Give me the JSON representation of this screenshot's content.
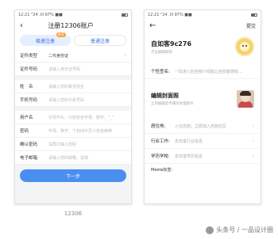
{
  "left_phone": {
    "status_time": "12:21 \"24 .lll 97% ■■",
    "title": "注册12306账户",
    "tabs": [
      {
        "label": "极速注册",
        "badge": "推荐"
      },
      {
        "label": "普通注册"
      }
    ],
    "fields": [
      {
        "label": "证件类型",
        "value": "二代身份证",
        "placeholder": ""
      },
      {
        "label": "证件号码",
        "value": "",
        "placeholder": "请输入身份证号码"
      },
      {
        "label": "姓　名",
        "value": "",
        "placeholder": "请输入您的真实姓名"
      },
      {
        "label": "手机号码",
        "value": "",
        "placeholder": "请输入您的手机号码"
      },
      {
        "label": "用户名",
        "value": "",
        "placeholder": "字母开头，只能包含字母、数字、\"_\""
      },
      {
        "label": "密码",
        "value": "",
        "placeholder": "字母、数字、下划线中至少包含两种"
      },
      {
        "label": "确认密码",
        "value": "",
        "placeholder": "请再次输入密码"
      },
      {
        "label": "电子邮箱",
        "value": "",
        "placeholder": "请输入您的邮箱，选填"
      }
    ],
    "next_label": "下一步",
    "caption": "12306"
  },
  "right_phone": {
    "status_time": "12:21 \"24 .lll 97% ■■",
    "save_label": "提交",
    "nickname": "自如客9c276",
    "nickname_sub": "点击编辑昵称",
    "signature_label": "个性签名:",
    "signature_value": "一段走心的自我介绍能让自如客感受...",
    "cover_title": "编辑封面照",
    "cover_sub": "立刻编辑您专属的封面照片",
    "rows": [
      {
        "label": "居住地:",
        "value": "入住自如，立即加入自如社区"
      },
      {
        "label": "行业工作:",
        "value": "去完善行业信息"
      },
      {
        "label": "学历学校:",
        "value": "去完善学历信息"
      }
    ],
    "meeta_label": "Meeta标签:"
  },
  "watermark": "头条号 / 一品设计圈"
}
